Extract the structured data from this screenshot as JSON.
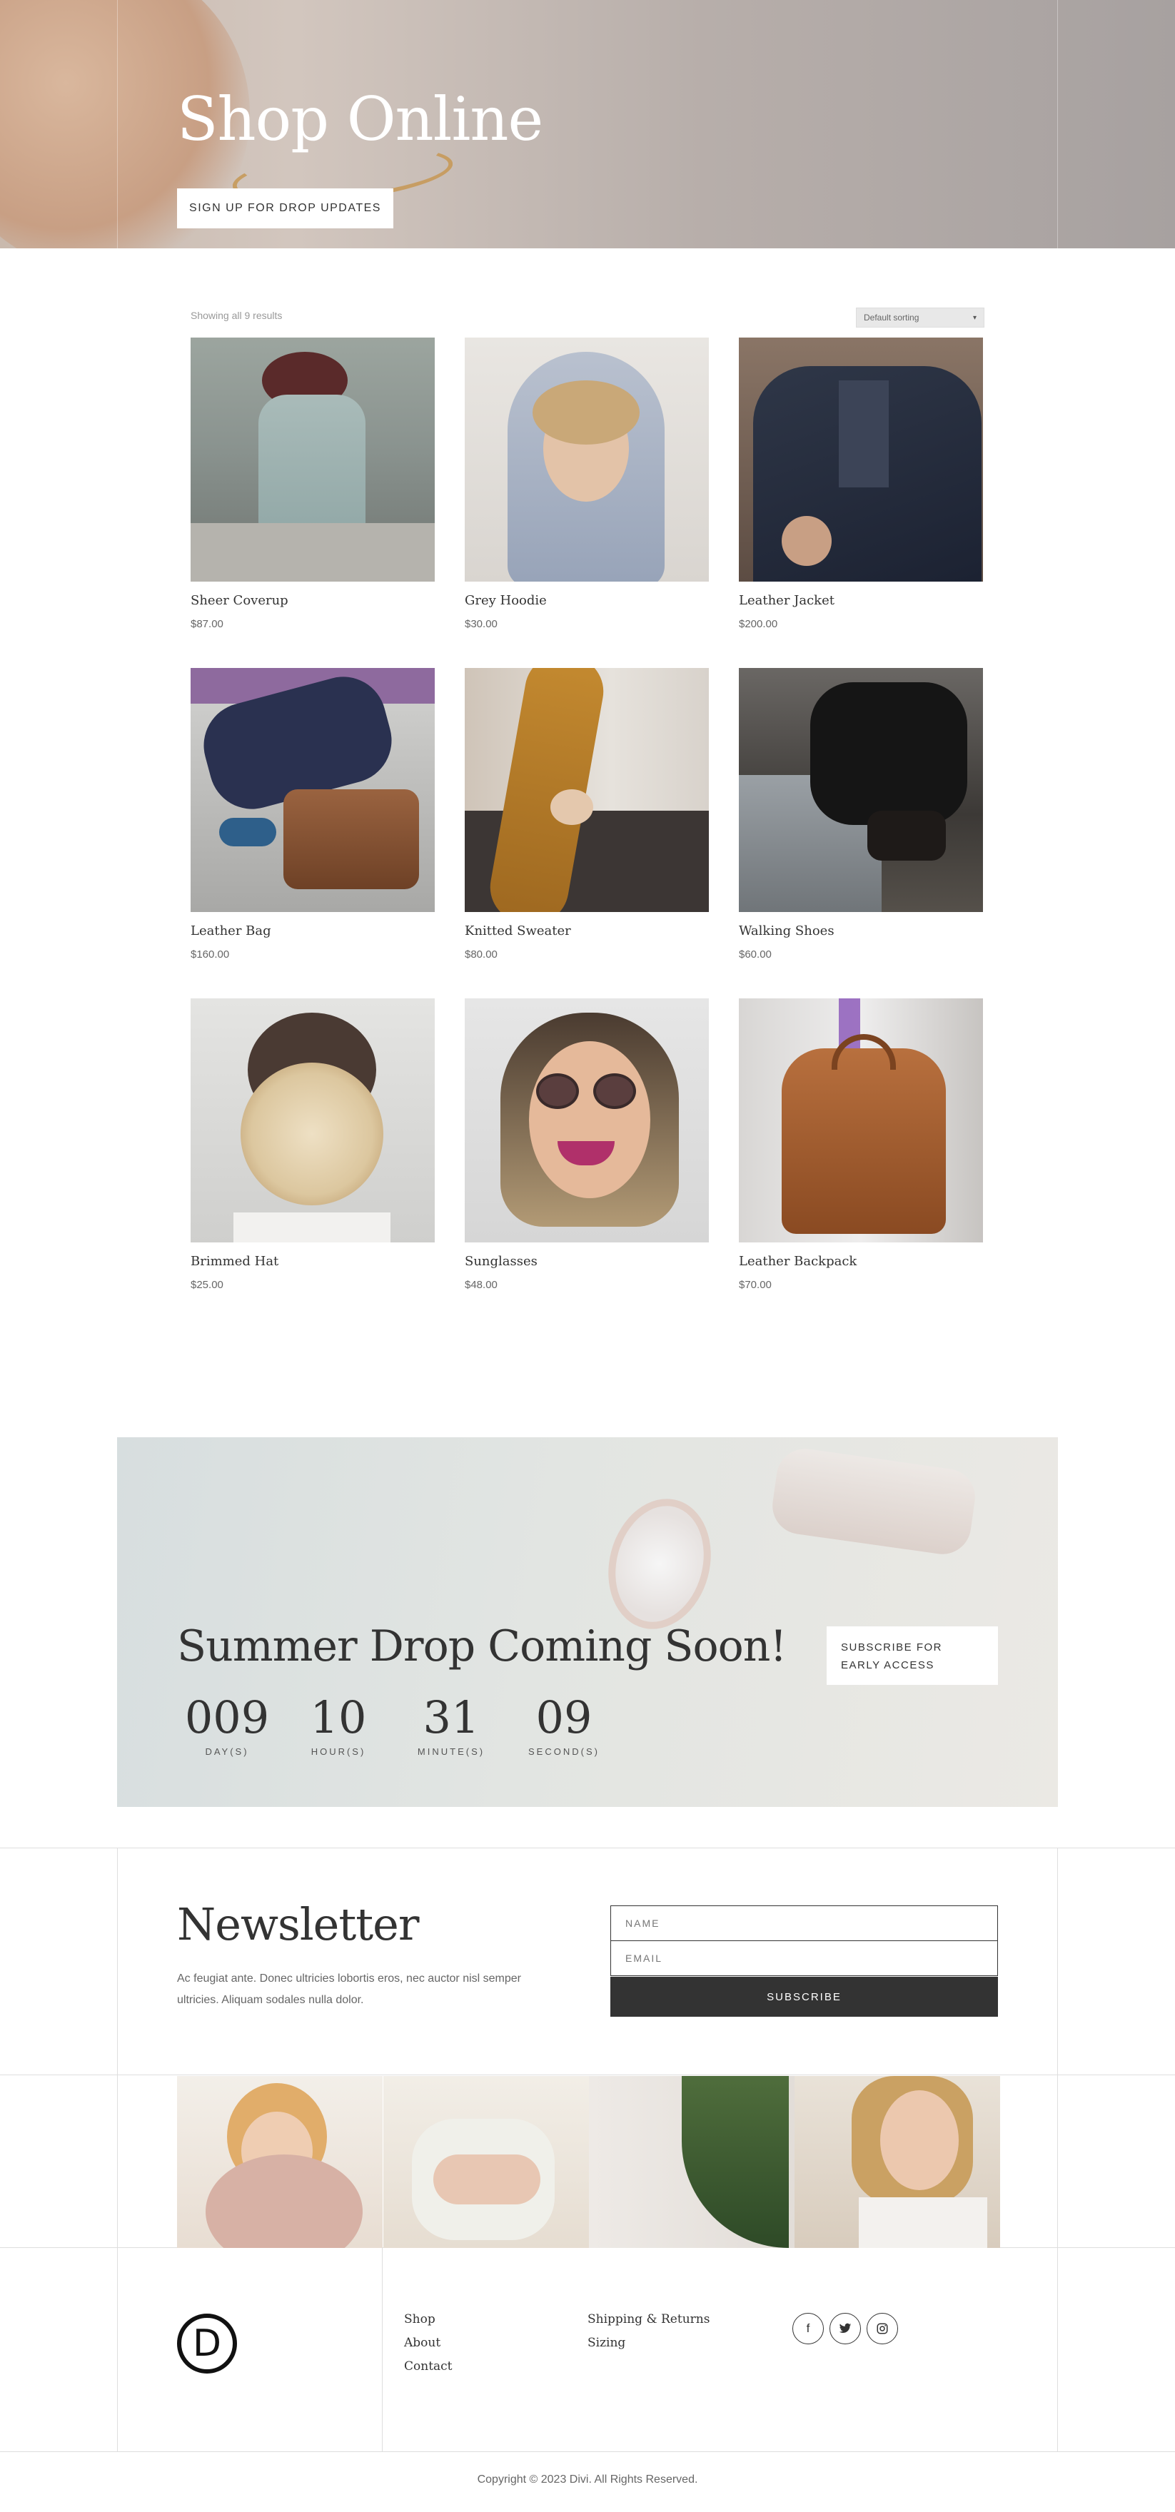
{
  "hero": {
    "title": "Shop Online",
    "button_label": "SIGN UP FOR DROP UPDATES"
  },
  "shop": {
    "result_count": "Showing all 9 results",
    "sort_selected": "Default sorting",
    "products": [
      {
        "name": "Sheer Coverup",
        "price": "$87.00"
      },
      {
        "name": "Grey Hoodie",
        "price": "$30.00"
      },
      {
        "name": "Leather Jacket",
        "price": "$200.00"
      },
      {
        "name": "Leather Bag",
        "price": "$160.00"
      },
      {
        "name": "Knitted Sweater",
        "price": "$80.00"
      },
      {
        "name": "Walking Shoes",
        "price": "$60.00"
      },
      {
        "name": "Brimmed Hat",
        "price": "$25.00"
      },
      {
        "name": "Sunglasses",
        "price": "$48.00"
      },
      {
        "name": "Leather Backpack",
        "price": "$70.00"
      }
    ]
  },
  "countdown": {
    "title": "Summer Drop Coming Soon!",
    "button_label": "SUBSCRIBE FOR EARLY ACCESS",
    "units": [
      {
        "value": "009",
        "label": "DAY(S)"
      },
      {
        "value": "10",
        "label": "HOUR(S)"
      },
      {
        "value": "31",
        "label": "MINUTE(S)"
      },
      {
        "value": "09",
        "label": "SECOND(S)"
      }
    ]
  },
  "newsletter": {
    "title": "Newsletter",
    "text": "Ac feugiat ante. Donec ultricies lobortis eros, nec auctor nisl semper ultricies. Aliquam sodales nulla dolor.",
    "name_placeholder": "NAME",
    "email_placeholder": "EMAIL",
    "subscribe_label": "SUBSCRIBE"
  },
  "footer": {
    "logo_letter": "D",
    "col1": [
      "Shop",
      "About",
      "Contact"
    ],
    "col2": [
      "Shipping & Returns",
      "Sizing"
    ],
    "social": [
      {
        "icon": "facebook-icon",
        "glyph": "f"
      },
      {
        "icon": "twitter-icon",
        "glyph": "t"
      },
      {
        "icon": "instagram-icon",
        "glyph": "◎"
      }
    ],
    "copyright": "Copyright © 2023 Divi. All Rights Reserved."
  }
}
